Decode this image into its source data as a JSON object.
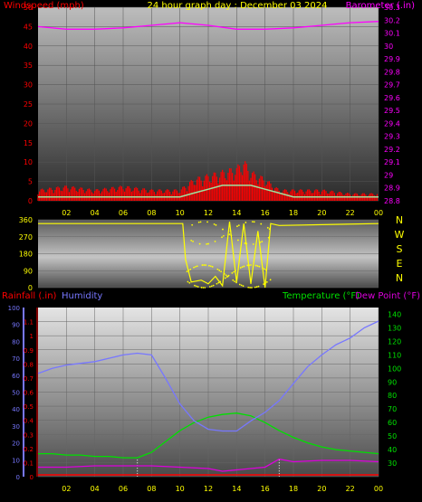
{
  "header": {
    "left_label": "Windspeed (mph)",
    "title": "24 hour graph day : December 03 2024",
    "right_label": "Barometer (.in)"
  },
  "mid_header": {
    "rain_label": "Rainfall (.in)",
    "humidity_label": "Humidity",
    "temp_label": "Temperature (°F)",
    "dew_label": "Dew Point (°F)"
  },
  "colors": {
    "wind": "#ff0000",
    "gust": "#ffffff",
    "avg_wind": "#9ee29e",
    "barometer": "#ff00ff",
    "direction": "#ffff00",
    "rain": "#ff0000",
    "humidity": "#7777ff",
    "temperature": "#00e000",
    "dewpoint": "#dd00dd",
    "time_text": "#ffff00"
  },
  "chart_data": [
    {
      "type": "line",
      "name": "wind-barometer",
      "x_ticks": [
        "02",
        "04",
        "06",
        "08",
        "10",
        "12",
        "14",
        "16",
        "18",
        "20",
        "22",
        "00"
      ],
      "y_left_ticks": [
        "0",
        "5",
        "10",
        "15",
        "20",
        "25",
        "30",
        "35",
        "40",
        "45",
        "50"
      ],
      "y_right_ticks": [
        "28.8",
        "28.9",
        "29",
        "29.1",
        "29.2",
        "29.3",
        "29.4",
        "29.5",
        "29.6",
        "29.7",
        "29.8",
        "29.9",
        "30",
        "30.1",
        "30.2",
        "30.3"
      ],
      "ylim_left": [
        0,
        50
      ],
      "ylim_right": [
        28.8,
        30.3
      ],
      "barometer": {
        "x": [
          0,
          2,
          4,
          6,
          8,
          10,
          12,
          14,
          16,
          18,
          20,
          22,
          24
        ],
        "y": [
          30.15,
          30.13,
          30.13,
          30.14,
          30.16,
          30.18,
          30.16,
          30.13,
          30.13,
          30.14,
          30.16,
          30.18,
          30.19
        ]
      },
      "wind_gust": {
        "x": [
          0,
          2,
          4,
          6,
          8,
          10,
          11,
          12,
          13,
          14,
          14.5,
          15,
          16,
          17,
          18,
          20,
          22,
          24
        ],
        "y": [
          3,
          4,
          3,
          4,
          3,
          3,
          6,
          7,
          8,
          9,
          11,
          8,
          6,
          3,
          3,
          3,
          2,
          2
        ]
      },
      "wind_avg": {
        "x": [
          0,
          2,
          4,
          6,
          8,
          10,
          11,
          12,
          13,
          14,
          15,
          16,
          17,
          18,
          20,
          22,
          24
        ],
        "y": [
          1,
          1,
          1,
          1,
          1,
          1,
          2,
          3,
          4,
          4,
          4,
          3,
          2,
          1,
          1,
          1,
          1
        ]
      }
    },
    {
      "type": "scatter",
      "name": "wind-direction",
      "x_ticks": [],
      "y_ticks": [
        "0",
        "90",
        "180",
        "270",
        "360"
      ],
      "compass": [
        "N",
        "W",
        "S",
        "E",
        "N"
      ],
      "ylim": [
        0,
        360
      ],
      "direction": {
        "x": [
          0,
          10.2,
          10.4,
          10.8,
          11.5,
          12,
          12.5,
          13,
          13.5,
          14,
          14.5,
          15,
          15.5,
          16,
          16.4,
          17,
          24
        ],
        "y": [
          340,
          340,
          150,
          30,
          40,
          20,
          60,
          10,
          350,
          30,
          340,
          20,
          300,
          0,
          340,
          330,
          340
        ]
      }
    },
    {
      "type": "line",
      "name": "temp-humidity-rain",
      "x_ticks": [
        "02",
        "04",
        "06",
        "08",
        "10",
        "12",
        "14",
        "16",
        "18",
        "20",
        "22",
        "00"
      ],
      "y_hum_ticks": [
        "0",
        "10",
        "20",
        "30",
        "40",
        "50",
        "60",
        "70",
        "80",
        "90",
        "100"
      ],
      "y_rain_ticks": [
        "0",
        "0.1",
        "0.2",
        "0.3",
        "0.4",
        "0.5",
        "0.6",
        "0.7",
        "0.8",
        "0.9",
        "1",
        "1.1"
      ],
      "y_temp_ticks": [
        "30",
        "40",
        "50",
        "60",
        "70",
        "80",
        "90",
        "100",
        "110",
        "120",
        "130",
        "140"
      ],
      "ylim_hum": [
        0,
        100
      ],
      "ylim_rain": [
        0,
        1.2
      ],
      "ylim_temp": [
        20,
        145
      ],
      "humidity": {
        "x": [
          0,
          1,
          2,
          3,
          4,
          5,
          6,
          7,
          8,
          9,
          10,
          11,
          12,
          13,
          14,
          15,
          16,
          17,
          18,
          19,
          20,
          21,
          22,
          23,
          24
        ],
        "y": [
          61,
          64,
          66,
          67,
          68,
          70,
          72,
          73,
          72,
          58,
          43,
          33,
          28,
          27,
          27,
          33,
          38,
          45,
          55,
          65,
          72,
          78,
          82,
          88,
          92
        ]
      },
      "temperature": {
        "x": [
          0,
          1,
          2,
          3,
          4,
          5,
          6,
          7,
          8,
          9,
          10,
          11,
          12,
          13,
          14,
          15,
          16,
          17,
          18,
          19,
          20,
          21,
          22,
          23,
          24
        ],
        "y": [
          37,
          37,
          36,
          36,
          35,
          35,
          34,
          34,
          38,
          46,
          54,
          60,
          64,
          66,
          67,
          65,
          60,
          54,
          49,
          45,
          42,
          40,
          39,
          38,
          37
        ]
      },
      "dewpoint": {
        "x": [
          0,
          2,
          4,
          6,
          8,
          10,
          12,
          13,
          14,
          15,
          16,
          17,
          18,
          20,
          22,
          24
        ],
        "y": [
          27,
          27,
          28,
          28,
          28,
          27,
          26,
          24,
          25,
          26,
          27,
          33,
          31,
          32,
          32,
          31
        ]
      }
    }
  ]
}
